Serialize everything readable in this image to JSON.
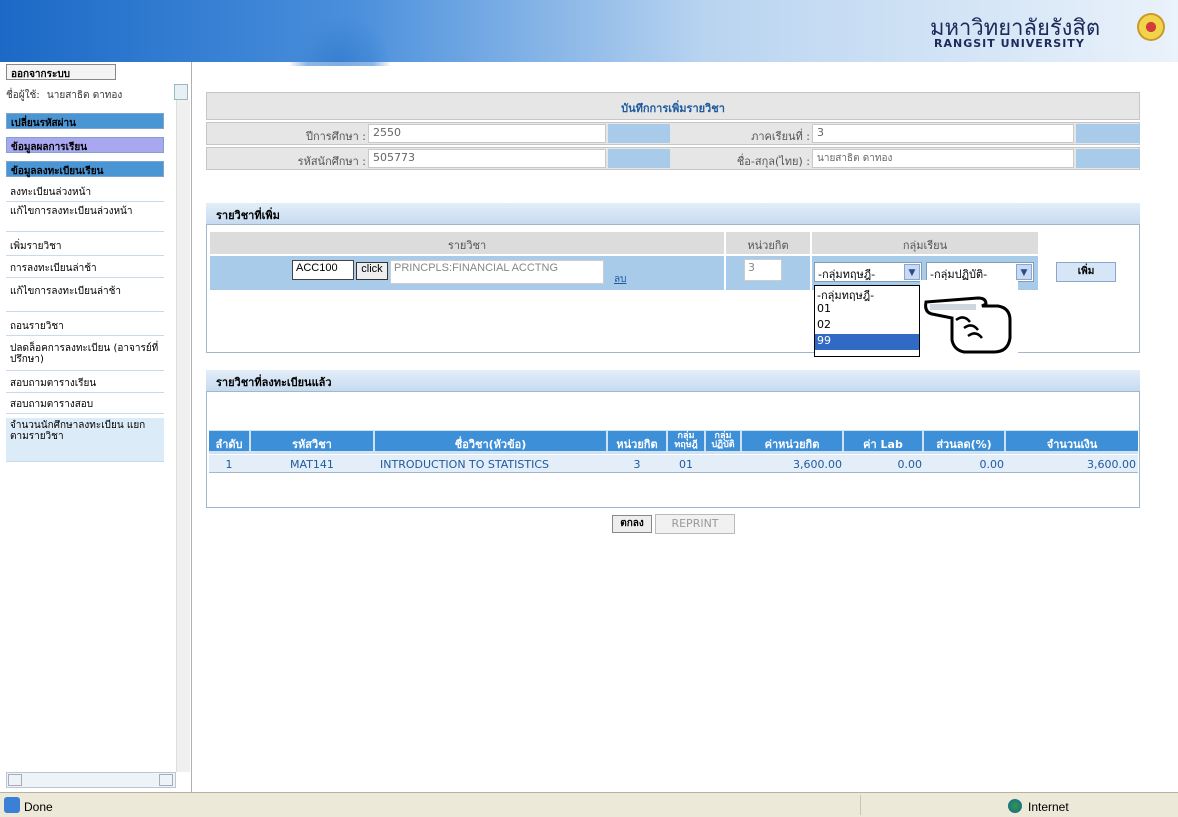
{
  "header": {
    "university_th": "มหาวิทยาลัยรังสิต",
    "university_en": "RANGSIT UNIVERSITY"
  },
  "sidebar": {
    "logout_label": "ออกจากระบบ",
    "user_label": "ชื่อผู้ใช้:",
    "user_name": "นายสาธิต ดาทอง",
    "headers": [
      "เปลี่ยนรหัสผ่าน",
      "ข้อมูลผลการเรียน",
      "ข้อมูลลงทะเบียนเรียน"
    ],
    "items": [
      "ลงทะเบียนล่วงหน้า",
      "แก้ไขการลงทะเบียนล่วงหน้า",
      "เพิ่มรายวิชา",
      "การลงทะเบียนล่าช้า",
      "แก้ไขการลงทะเบียนล่าช้า",
      "ถอนรายวิชา",
      "ปลดล็อคการลงทะเบียน (อาจารย์ที่ปรึกษา)",
      "สอบถามตารางเรียน",
      "สอบถามตารางสอบ",
      "จำนวนนักศึกษาลงทะเบียน แยกตามรายวิชา"
    ]
  },
  "record": {
    "title": "บันทึกการเพิ่มรายวิชา",
    "year_label": "ปีการศึกษา :",
    "year_value": "2550",
    "term_label": "ภาคเรียนที่ :",
    "term_value": "3",
    "student_id_label": "รหัสนักศึกษา :",
    "student_id_value": "505773",
    "name_label": "ชื่อ-สกุล(ไทย) :",
    "name_value": "นายสาธิต ดาทอง"
  },
  "add_panel": {
    "title": "รายวิชาที่เพิ่ม",
    "col_course": "รายวิชา",
    "col_credit": "หน่วยกิต",
    "col_group": "กลุ่มเรียน",
    "course_code": "ACC100",
    "click_label": "click",
    "course_name": "PRINCPLS:FINANCIAL ACCTNG",
    "delete_label": "ลบ",
    "credit": "3",
    "theory_select": "-กลุ่มทฤษฎี-",
    "practice_select": "-กลุ่มปฏิบัติ-",
    "add_button": "เพิ่ม",
    "dropdown_options": [
      "-กลุ่มทฤษฎี-",
      "01",
      "02",
      "99"
    ],
    "dropdown_selected": "99"
  },
  "registered_panel": {
    "title": "รายวิชาที่ลงทะเบียนแล้ว",
    "columns": [
      "ลำดับ",
      "รหัสวิชา",
      "ชื่อวิชา(หัวข้อ)",
      "หน่วยกิต",
      "กลุ่ม ทฤษฎี",
      "กลุ่ม ปฏิบัติ",
      "ค่าหน่วยกิต",
      "ค่า Lab",
      "ส่วนลด(%)",
      "จำนวนเงิน"
    ],
    "rows": [
      {
        "no": "1",
        "code": "MAT141",
        "name": "INTRODUCTION TO STATISTICS",
        "credit": "3",
        "theory": "01",
        "practice": "",
        "credit_fee": "3,600.00",
        "lab_fee": "0.00",
        "discount": "0.00",
        "amount": "3,600.00"
      }
    ]
  },
  "buttons": {
    "ok": "ตกลง",
    "reprint": "REPRINT"
  },
  "statusbar": {
    "status": "Done",
    "zone": "Internet"
  }
}
